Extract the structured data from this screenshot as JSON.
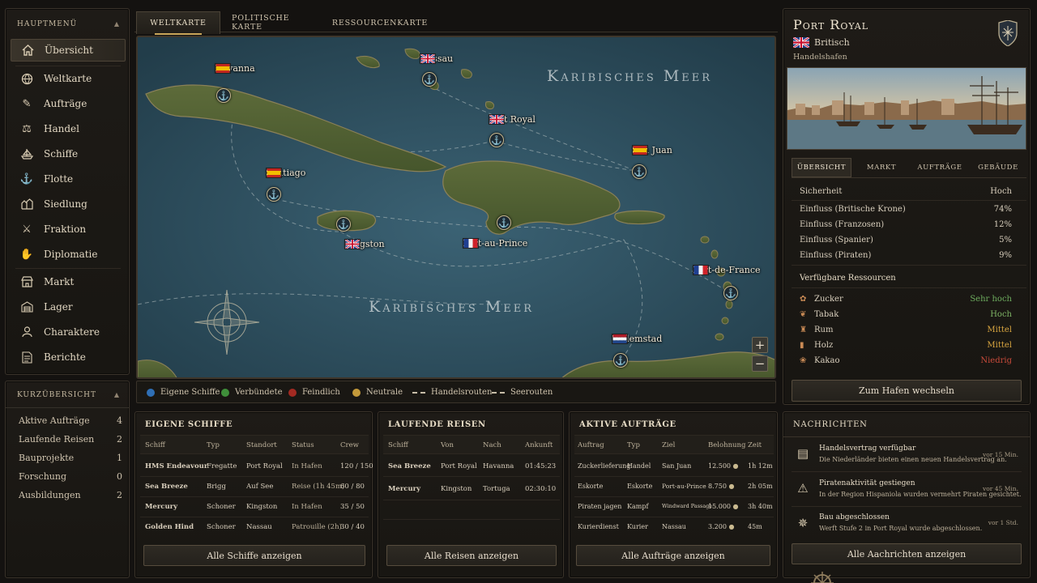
{
  "sidebar": {
    "title": "HAUPTMENÜ",
    "items": [
      {
        "label": "Übersicht",
        "icon": "home-icon"
      },
      {
        "label": "Weltkarte",
        "icon": "globe-icon"
      },
      {
        "label": "Aufträge",
        "icon": "quill-icon"
      },
      {
        "label": "Handel",
        "icon": "trade-icon"
      },
      {
        "label": "Schiffe",
        "icon": "ship-icon"
      },
      {
        "label": "Flotte",
        "icon": "fleet-icon"
      },
      {
        "label": "Siedlung",
        "icon": "settlement-icon"
      },
      {
        "label": "Fraktion",
        "icon": "faction-icon"
      },
      {
        "label": "Diplomatie",
        "icon": "handshake-icon"
      },
      {
        "label": "Markt",
        "icon": "market-icon"
      },
      {
        "label": "Lager",
        "icon": "warehouse-icon"
      },
      {
        "label": "Charaktere",
        "icon": "characters-icon"
      },
      {
        "label": "Berichte",
        "icon": "reports-icon"
      }
    ]
  },
  "quick": {
    "title": "KURZÜBERSICHT",
    "rows": [
      {
        "label": "Aktive Aufträge",
        "value": "4"
      },
      {
        "label": "Laufende Reisen",
        "value": "2"
      },
      {
        "label": "Bauprojekte",
        "value": "1"
      },
      {
        "label": "Forschung",
        "value": "0"
      },
      {
        "label": "Ausbildungen",
        "value": "2"
      }
    ]
  },
  "map_tabs": [
    "WELTKARTE",
    "POLITISCHE KARTE",
    "RESSOURCENKARTE"
  ],
  "map": {
    "sea_labels": [
      "Karibisches Meer",
      "Karibisches Meer"
    ],
    "cities": [
      {
        "name": "Havanna",
        "flag": "es"
      },
      {
        "name": "Nassau",
        "flag": "gb"
      },
      {
        "name": "Port Royal",
        "flag": "gb"
      },
      {
        "name": "San Juan",
        "flag": "es"
      },
      {
        "name": "Santiago",
        "flag": "es"
      },
      {
        "name": "Kingston",
        "flag": "gb"
      },
      {
        "name": "Port-au-Prince",
        "flag": "fr"
      },
      {
        "name": "Fort-de-France",
        "flag": "fr"
      },
      {
        "name": "Willemstad",
        "flag": "nl"
      }
    ],
    "zoom_in": "+",
    "zoom_out": "−"
  },
  "legend": [
    {
      "label": "Eigene Schiffe",
      "color": "#2f6fb5"
    },
    {
      "label": "Verbündete",
      "color": "#3f8f3a"
    },
    {
      "label": "Feindlich",
      "color": "#a32a22"
    },
    {
      "label": "Neutrale",
      "color": "#c49a3a"
    },
    {
      "label": "Handelsrouten"
    },
    {
      "label": "Seerouten"
    }
  ],
  "ships": {
    "title": "EIGENE SCHIFFE",
    "headers": [
      "Schiff",
      "Typ",
      "Standort",
      "Status",
      "Crew"
    ],
    "rows": [
      [
        "HMS Endeavour",
        "Fregatte",
        "Port Royal",
        "In Hafen",
        "120 / 150"
      ],
      [
        "Sea Breeze",
        "Brigg",
        "Auf See",
        "Reise (1h 45m)",
        "60 / 80"
      ],
      [
        "Mercury",
        "Schoner",
        "Kingston",
        "In Hafen",
        "35 / 50"
      ],
      [
        "Golden Hind",
        "Schoner",
        "Nassau",
        "Patrouille (2h)",
        "30 / 40"
      ]
    ],
    "button": "Alle Schiffe anzeigen"
  },
  "voyages": {
    "title": "LAUFENDE REISEN",
    "headers": [
      "Schiff",
      "Von",
      "Nach",
      "Ankunft"
    ],
    "rows": [
      [
        "Sea Breeze",
        "Port Royal",
        "Havanna",
        "01:45:23"
      ],
      [
        "Mercury",
        "Kingston",
        "Tortuga",
        "02:30:10"
      ]
    ],
    "button": "Alle Reisen anzeigen"
  },
  "orders": {
    "title": "AKTIVE AUFTRÄGE",
    "headers": [
      "Auftrag",
      "Typ",
      "Ziel",
      "Belohnung",
      "Zeit"
    ],
    "rows": [
      [
        "Zuckerlieferung",
        "Handel",
        "San Juan",
        "12.500",
        "1h 12m"
      ],
      [
        "Eskorte",
        "Eskorte",
        "Port-au-Prince",
        "8.750",
        "2h 05m"
      ],
      [
        "Piraten jagen",
        "Kampf",
        "Windward Passage",
        "15.000",
        "3h 40m"
      ],
      [
        "Kurierdienst",
        "Kurier",
        "Nassau",
        "3.200",
        "45m"
      ]
    ],
    "button": "Alle Aufträge anzeigen"
  },
  "port": {
    "name": "Port Royal",
    "nation": "Britisch",
    "type": "Handelshafen",
    "tabs": [
      "ÜBERSICHT",
      "MARKT",
      "AUFTRÄGE",
      "GEBÄUDE"
    ],
    "security_label": "Sicherheit",
    "security_value": "Hoch",
    "influence": [
      {
        "label": "Einfluss (Britische Krone)",
        "value": "74%"
      },
      {
        "label": "Einfluss (Franzosen)",
        "value": "12%"
      },
      {
        "label": "Einfluss (Spanier)",
        "value": "5%"
      },
      {
        "label": "Einfluss (Piraten)",
        "value": "9%"
      }
    ],
    "resources_title": "Verfügbare Ressourcen",
    "resources": [
      {
        "label": "Zucker",
        "value": "Sehr hoch",
        "color": "#6fae5f"
      },
      {
        "label": "Tabak",
        "value": "Hoch",
        "color": "#7fb565"
      },
      {
        "label": "Rum",
        "value": "Mittel",
        "color": "#d9a640"
      },
      {
        "label": "Holz",
        "value": "Mittel",
        "color": "#d9a640"
      },
      {
        "label": "Kakao",
        "value": "Niedrig",
        "color": "#c84a3a"
      }
    ],
    "button": "Zum Hafen wechseln"
  },
  "news": {
    "title": "NACHRICHTEN",
    "items": [
      {
        "title": "Handelsvertrag verfügbar",
        "text": "Die Niederländer bieten einen neuen Handelsvertrag an.",
        "time": "vor 15 Min."
      },
      {
        "title": "Piratenaktivität gestiegen",
        "text": "In der Region Hispaniola wurden vermehrt Piraten gesichtet.",
        "time": "vor 45 Min."
      },
      {
        "title": "Bau abgeschlossen",
        "text": "Werft Stufe 2 in Port Royal wurde abgeschlossen.",
        "time": "vor 1 Std."
      }
    ],
    "button": "Alle Aachrichten anzeigen"
  }
}
